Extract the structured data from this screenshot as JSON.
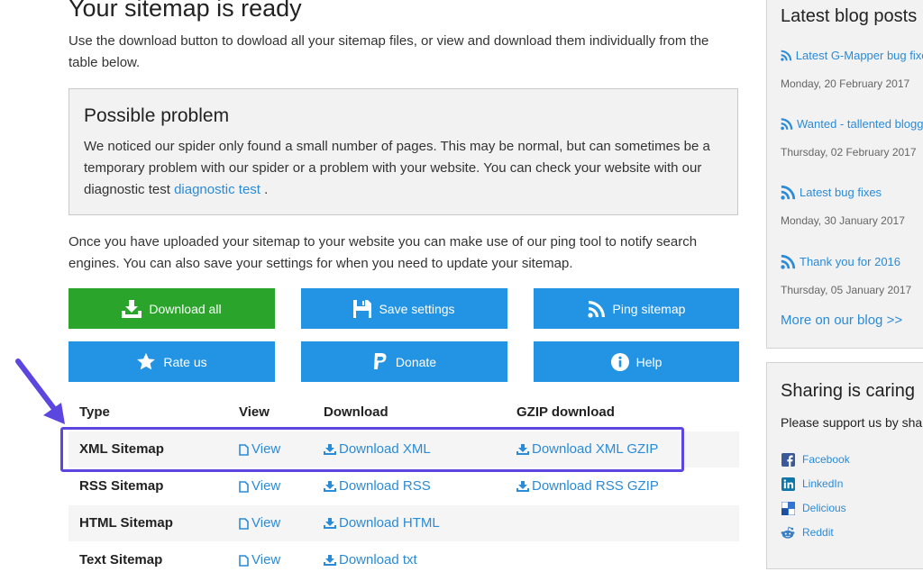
{
  "page": {
    "title": "Your sitemap is ready",
    "intro": "Use the download button to dowload all your sitemap files, or view and download them individually from the table below."
  },
  "problem": {
    "title": "Possible problem",
    "text": "We noticed our spider only found a small number of pages. This may be normal, but can sometimes be a temporary problem with our spider or a problem with your website. You can check your website with our diagnostic test",
    "link": "diagnostic test",
    "end": " ."
  },
  "ping_text": "Once you have uploaded your sitemap to your website you can make use of our ping tool to notify search engines. You can also save your settings for when you need to update your sitemap.",
  "buttons": {
    "download_all": "Download all",
    "save_settings": "Save settings",
    "ping_sitemap": "Ping sitemap",
    "rate_us": "Rate us",
    "donate": "Donate",
    "help": "Help"
  },
  "colors": {
    "green": "#2aa42a",
    "blue": "#2394e4",
    "link": "#2a8bd8",
    "highlight": "#5b47e0"
  },
  "table": {
    "headers": [
      "Type",
      "View",
      "Download",
      "GZIP download"
    ],
    "rows": [
      {
        "type": "XML Sitemap",
        "view": "View",
        "download": "Download XML",
        "gzip": "Download XML GZIP"
      },
      {
        "type": "RSS Sitemap",
        "view": "View",
        "download": "Download RSS",
        "gzip": "Download RSS GZIP"
      },
      {
        "type": "HTML Sitemap",
        "view": "View",
        "download": "Download HTML",
        "gzip": ""
      },
      {
        "type": "Text Sitemap",
        "view": "View",
        "download": "Download txt",
        "gzip": ""
      }
    ]
  },
  "sidebar": {
    "blog_title": "Latest blog posts",
    "posts": [
      {
        "title": "Latest G-Mapper bug fixes",
        "date": "Monday, 20 February 2017"
      },
      {
        "title": "Wanted - tallented blogger",
        "date": "Thursday, 02 February 2017"
      },
      {
        "title": "Latest bug fixes",
        "date": "Monday, 30 January 2017"
      },
      {
        "title": "Thank you for 2016",
        "date": "Thursday, 05 January 2017"
      }
    ],
    "more": "More on our blog >>",
    "sharing_title": "Sharing is caring",
    "support_text": "Please support us by sharing",
    "social": [
      "Facebook",
      "LinkedIn",
      "Delicious",
      "Reddit"
    ]
  }
}
